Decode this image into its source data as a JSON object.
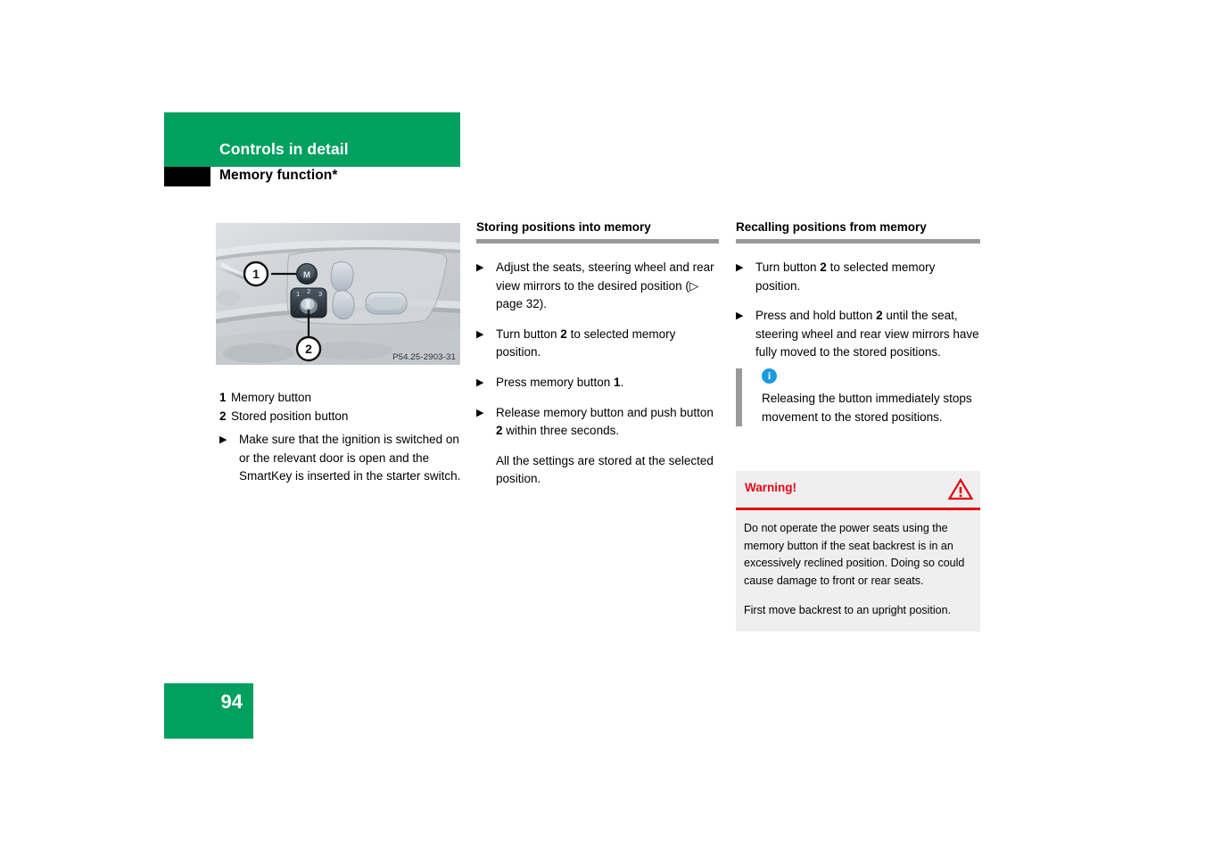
{
  "header": {
    "chapter": "Controls in detail",
    "section": "Memory function*"
  },
  "illustration": {
    "image_code": "P54.25-2903-31",
    "callout_1": "1",
    "callout_2": "2",
    "memory_button_glyph": "M",
    "dial_positions": [
      "1",
      "2",
      "3"
    ]
  },
  "legend": {
    "items": [
      {
        "num": "1",
        "text": "Memory button"
      },
      {
        "num": "2",
        "text": "Stored position button"
      }
    ]
  },
  "left_note": {
    "bullet": "▶",
    "text": "Make sure that the ignition is switched on or the relevant door is open and the SmartKey is inserted in the starter switch."
  },
  "storing": {
    "heading": "Storing positions into memory",
    "bullet": "▶",
    "items": [
      {
        "type": "bullet",
        "parts": [
          {
            "t": "Adjust the seats, steering wheel and rear view mirrors to the desired position ("
          },
          {
            "t": "▷",
            "style": "ref"
          },
          {
            "t": " page 32)."
          }
        ],
        "plain": "Adjust the seats, steering wheel and rear view mirrors to the desired position (▷ page 32)."
      },
      {
        "type": "bullet",
        "parts": [
          {
            "t": "Turn button "
          },
          {
            "t": "2",
            "style": "bold"
          },
          {
            "t": " to selected memory position."
          }
        ],
        "plain": "Turn button 2 to selected memory position."
      },
      {
        "type": "bullet",
        "parts": [
          {
            "t": "Press memory button "
          },
          {
            "t": "1",
            "style": "bold"
          },
          {
            "t": "."
          }
        ],
        "plain": "Press memory button 1."
      },
      {
        "type": "bullet",
        "parts": [
          {
            "t": "Release memory button and push button "
          },
          {
            "t": "2",
            "style": "bold"
          },
          {
            "t": " within three seconds."
          }
        ],
        "plain": "Release memory button and push button 2 within three seconds."
      },
      {
        "type": "plain",
        "parts": [
          {
            "t": "All the settings are stored at the selected position."
          }
        ],
        "plain": "All the settings are stored at the selected position."
      }
    ]
  },
  "recalling": {
    "heading": "Recalling positions from memory",
    "bullet": "▶",
    "items": [
      {
        "type": "bullet",
        "parts": [
          {
            "t": "Turn button "
          },
          {
            "t": "2",
            "style": "bold"
          },
          {
            "t": " to selected memory position."
          }
        ],
        "plain": "Turn button 2 to selected memory position."
      },
      {
        "type": "bullet",
        "parts": [
          {
            "t": "Press and hold button "
          },
          {
            "t": "2",
            "style": "bold"
          },
          {
            "t": " until the seat, steering wheel and rear view mirrors have fully moved to the stored positions."
          }
        ],
        "plain": "Press and hold button 2 until the seat, steering wheel and rear view mirrors have fully moved to the stored positions."
      }
    ]
  },
  "info_note": {
    "icon_glyph": "i",
    "text": "Releasing the button immediately stops movement to the stored positions."
  },
  "warning": {
    "label": "Warning!",
    "icon_glyph": "!",
    "paragraph_1": "Do not operate the power seats using the memory button if the seat backrest is in an excessively reclined position. Doing so could cause damage to front or rear seats.",
    "paragraph_2": "First move backrest to an upright position."
  },
  "footer": {
    "page_number": "94"
  },
  "colors": {
    "brand_green": "#00a05e",
    "warning_red": "#e30613",
    "info_blue": "#1a9ade",
    "rule_gray": "#999999",
    "warning_bg": "#efefef"
  }
}
